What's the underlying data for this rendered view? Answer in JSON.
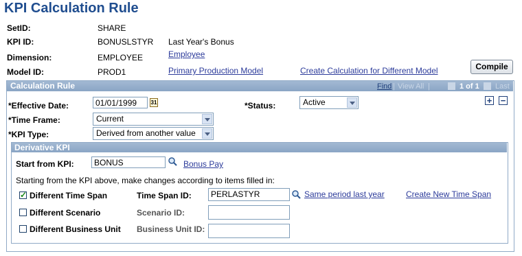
{
  "page": {
    "title": "KPI Calculation Rule"
  },
  "header": {
    "setid_label": "SetID:",
    "setid_value": "SHARE",
    "kpi_id_label": "KPI ID:",
    "kpi_id_value": "BONUSLSTYR",
    "kpi_id_descr": "Last Year's Bonus",
    "dimension_label": "Dimension:",
    "dimension_value": "EMPLOYEE",
    "dimension_link": "Employee",
    "model_id_label": "Model ID:",
    "model_id_value": "PROD1",
    "model_link": "Primary Production Model",
    "create_calc_link": "Create Calculation for Different Model",
    "compile_button": "Compile"
  },
  "calc_rule": {
    "title": "Calculation Rule",
    "nav": {
      "find": "Find",
      "view_all": "View All",
      "count": "1 of 1",
      "last": "Last",
      "separator": "|"
    },
    "effective_date_label": "*Effective Date:",
    "effective_date_value": "01/01/1999",
    "calendar_icon_text": "31",
    "status_label": "*Status:",
    "status_value": "Active",
    "time_frame_label": "*Time Frame:",
    "time_frame_value": "Current",
    "kpi_type_label": "*KPI Type:",
    "kpi_type_value": "Derived from another value",
    "add_row_symbol": "+",
    "delete_row_symbol": "−"
  },
  "derivative": {
    "title": "Derivative KPI",
    "start_from_label": "Start from KPI:",
    "start_from_value": "BONUS",
    "start_from_link": "Bonus Pay",
    "instructions": "Starting from the KPI above, make changes according to items filled in:",
    "diff_time_span_label": "Different Time Span",
    "diff_time_span_checked": true,
    "time_span_label": "Time Span ID:",
    "time_span_value": "PERLASTYR",
    "time_span_link": "Same period last year",
    "create_time_span_link": "Create New Time Span",
    "diff_scenario_label": "Different Scenario",
    "diff_scenario_checked": false,
    "scenario_label": "Scenario ID:",
    "scenario_value": "",
    "diff_bu_label": "Different Business Unit",
    "diff_bu_checked": false,
    "bu_label": "Business Unit ID:",
    "bu_value": ""
  },
  "colors": {
    "title": "#1f4d8f",
    "link": "#2b3a9a",
    "header_bg": "#8aa5c5",
    "border": "#8fa9c6"
  }
}
